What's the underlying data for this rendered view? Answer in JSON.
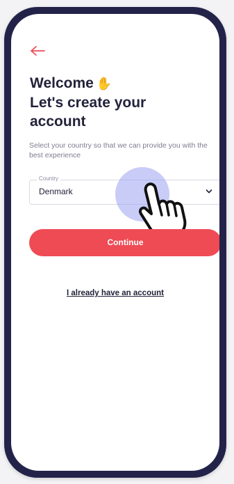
{
  "welcome": {
    "title_line1": "Welcome",
    "title_line2": "Let's create your",
    "title_line3": "account",
    "subtitle": "Select your country so that we can provide you with the best experience"
  },
  "country_select": {
    "label": "Country",
    "value": "Denmark"
  },
  "continue_button": {
    "label": "Continue"
  },
  "login_link": {
    "label": "I already have an account"
  },
  "icons": [
    "back-arrow-icon",
    "waving-hand-icon",
    "chevron-down-icon",
    "tap-hand-icon"
  ],
  "colors": {
    "accent": "#EE4B55",
    "text": "#22223A",
    "muted": "#7D7D91",
    "frame": "#23234A",
    "touch_highlight": "#9BA2F0"
  }
}
